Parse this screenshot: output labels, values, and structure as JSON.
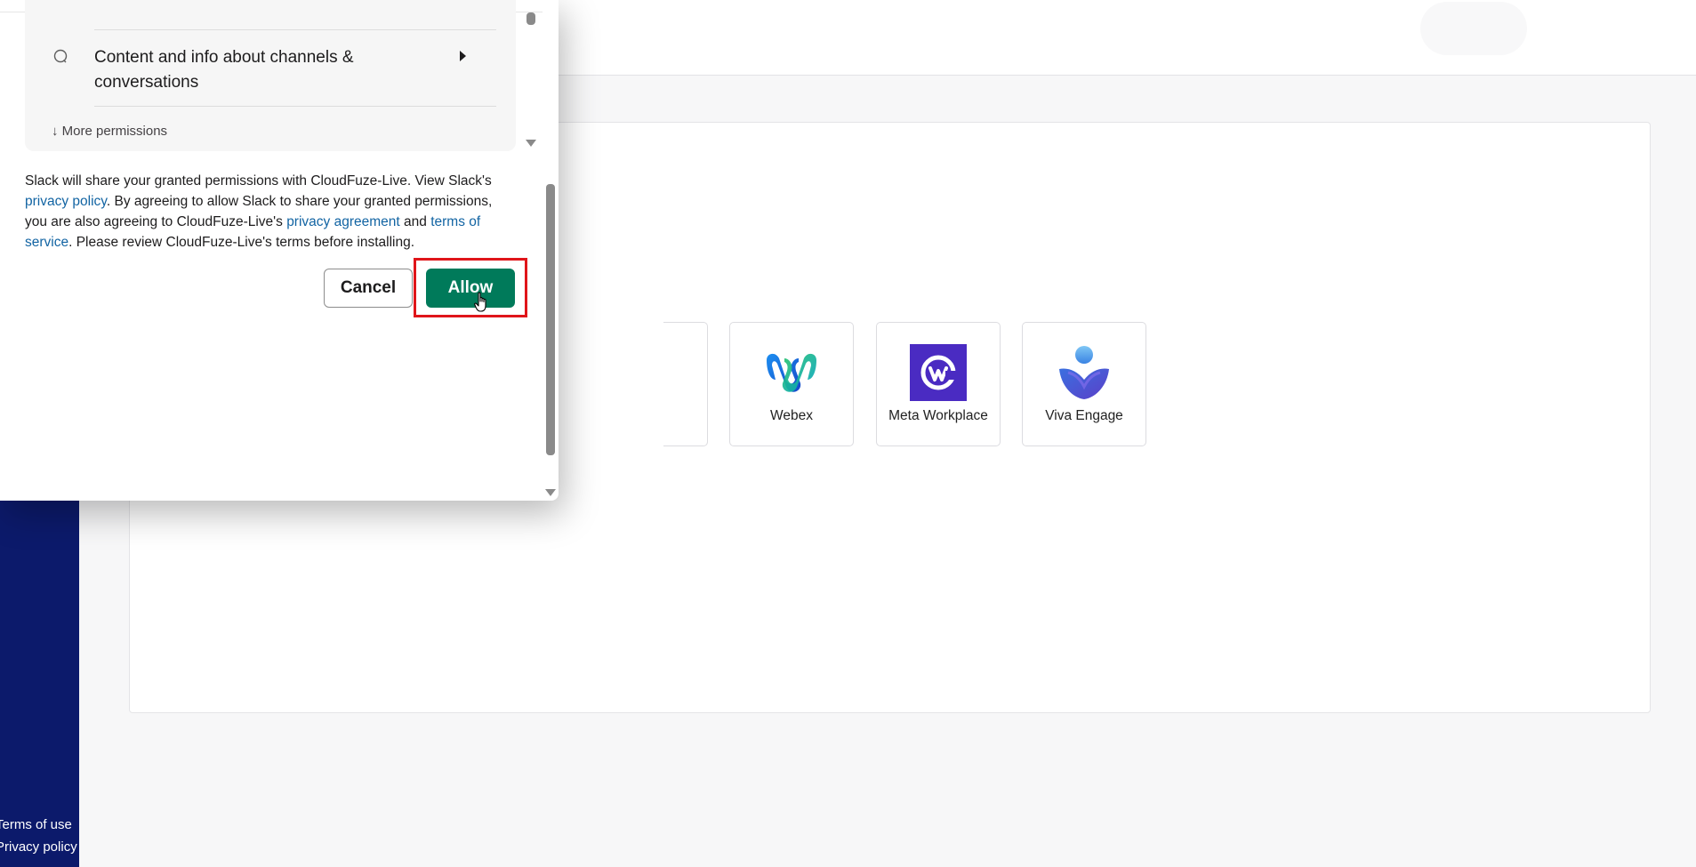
{
  "sidebar": {
    "links": [
      "Terms of use",
      "Privacy policy"
    ]
  },
  "apps": [
    {
      "label": "Webex",
      "icon": "webex-logo-icon"
    },
    {
      "label": "Meta Workplace",
      "icon": "meta-workplace-logo-icon"
    },
    {
      "label": "Viva Engage",
      "icon": "viva-engage-logo-icon"
    }
  ],
  "modal": {
    "permission_item": "Content and info about channels & conversations",
    "more_permissions": "More permissions",
    "more_permissions_arrow": "↓",
    "disclaimer": {
      "p1": "Slack will share your granted permissions with CloudFuze-Live. View Slack's ",
      "privacy_policy": "privacy policy",
      "p2": ". By agreeing to allow Slack to share your granted permissions, you are also agreeing to CloudFuze-Live's ",
      "privacy_agreement": "privacy agreement",
      "p3": " and ",
      "terms_of_service": "terms of service",
      "p4": ". Please review CloudFuze-Live's terms before installing."
    },
    "cancel_label": "Cancel",
    "allow_label": "Allow"
  },
  "colors": {
    "sidebar": "#0c1a6b",
    "allow_button": "#007a5a",
    "link": "#1264a3",
    "highlight": "#e0151a",
    "meta_purple": "#4a2bc2"
  }
}
